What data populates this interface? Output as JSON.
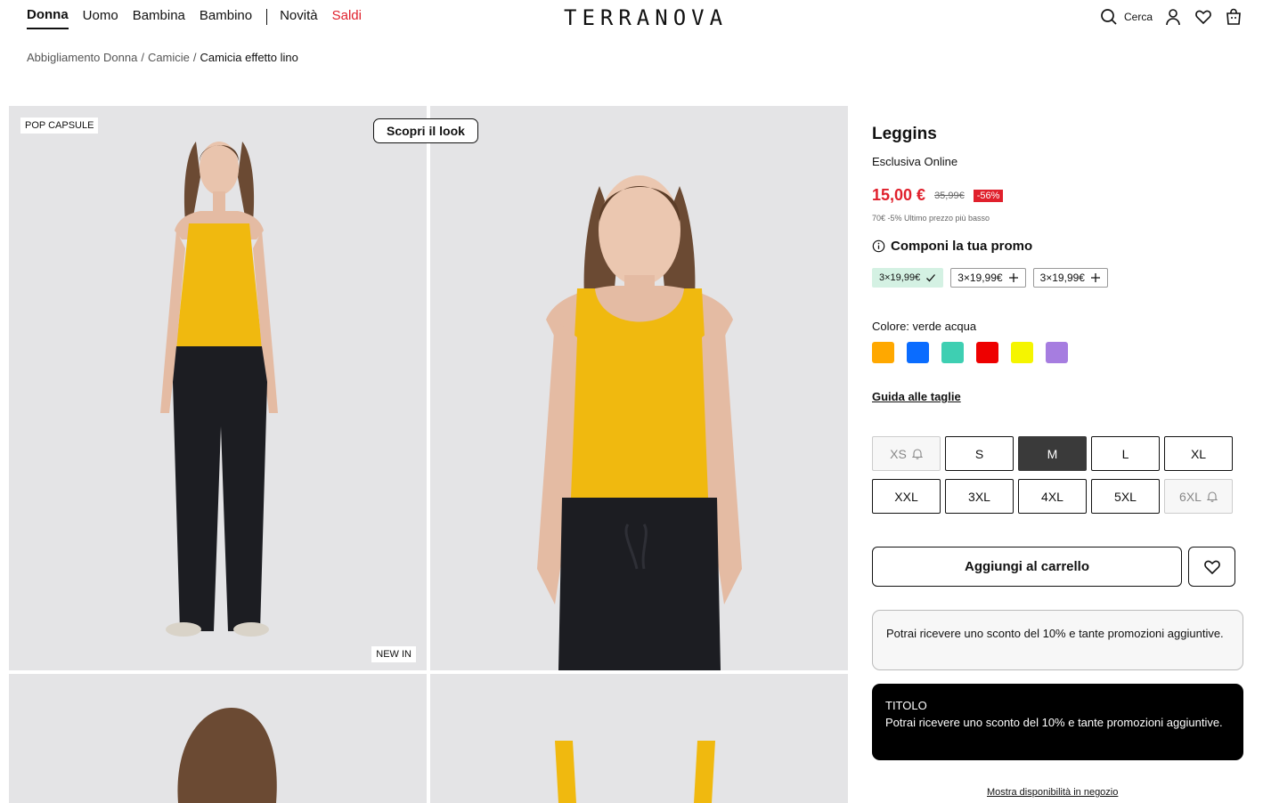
{
  "header": {
    "nav": [
      {
        "label": "Donna"
      },
      {
        "label": "Uomo"
      },
      {
        "label": "Bambina"
      },
      {
        "label": "Bambino"
      }
    ],
    "nav_secondary": [
      {
        "label": "Novità"
      },
      {
        "label": "Saldi"
      }
    ],
    "logo": "TERRANOVA",
    "search_label": "Cerca"
  },
  "breadcrumb": [
    "Abbigliamento Donna",
    "Camicie",
    "Camicia effetto lino"
  ],
  "gallery": {
    "badge_top": "POP CAPSULE",
    "badge_bottom": "NEW IN",
    "look_button": "Scopri il look"
  },
  "product": {
    "title": "Leggins",
    "subtitle": "Esclusiva Online",
    "price": "15,00 €",
    "old_price": "35,99€",
    "discount": "-56%",
    "lowest_price_note": "70€ -5% Ultimo prezzo più basso",
    "promo_title": "Componi la tua promo",
    "promo_chips": [
      "3×19,99€",
      "3×19,99€",
      "3×19,99€"
    ],
    "color_label": "Colore: verde acqua",
    "colors": [
      "#ffa800",
      "#0a6cff",
      "#3ecfb2",
      "#ee0000",
      "#f5f500",
      "#a67de0"
    ],
    "size_guide": "Guida alle taglie",
    "sizes": [
      "XS",
      "S",
      "M",
      "L",
      "XL",
      "XXL",
      "3XL",
      "4XL",
      "5XL",
      "6XL"
    ],
    "add_to_cart": "Aggiungi al carrello",
    "info_text": "Potrai ricevere uno sconto del 10% e tante promozioni aggiuntive.",
    "black_title": "TITOLO",
    "black_text": "Potrai ricevere uno sconto del 10% e tante promozioni aggiuntive.",
    "store_link": "Mostra disponibilità in negozio"
  },
  "colors": {
    "sale_red": "#e0202c",
    "promo_green": "#d4f1e3",
    "selected_size": "#3a3a3a"
  }
}
